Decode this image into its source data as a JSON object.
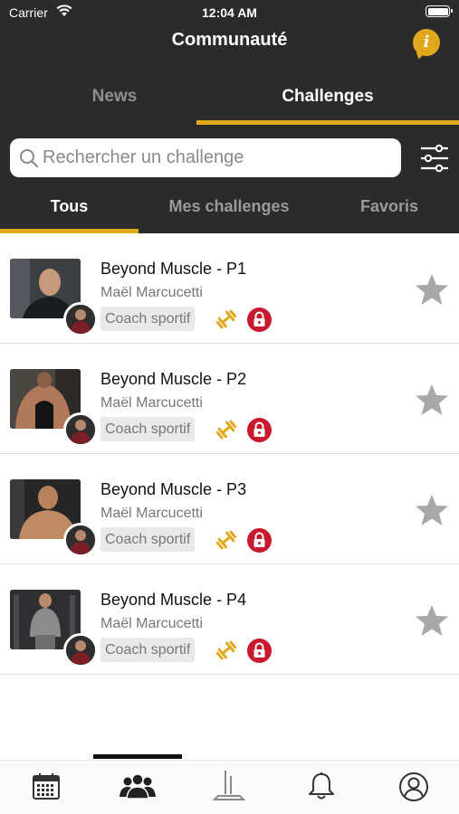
{
  "status_bar": {
    "carrier": "Carrier",
    "time": "12:04 AM"
  },
  "header": {
    "title": "Communauté",
    "info_icon": "i"
  },
  "top_tabs": [
    {
      "label": "News",
      "active": false
    },
    {
      "label": "Challenges",
      "active": true
    }
  ],
  "search": {
    "placeholder": "Rechercher un challenge",
    "value": ""
  },
  "sub_tabs": [
    {
      "label": "Tous",
      "active": true
    },
    {
      "label": "Mes challenges",
      "active": false
    },
    {
      "label": "Favoris",
      "active": false
    }
  ],
  "challenges": [
    {
      "title": "Beyond Muscle - P1",
      "author": "Maël Marcucetti",
      "badge": "Coach sportif",
      "locked": true,
      "favorite": false
    },
    {
      "title": "Beyond Muscle - P2",
      "author": "Maël Marcucetti",
      "badge": "Coach sportif",
      "locked": true,
      "favorite": false
    },
    {
      "title": "Beyond Muscle - P3",
      "author": "Maël Marcucetti",
      "badge": "Coach sportif",
      "locked": true,
      "favorite": false
    },
    {
      "title": "Beyond Muscle - P4",
      "author": "Maël Marcucetti",
      "badge": "Coach sportif",
      "locked": true,
      "favorite": false
    }
  ],
  "tab_bar": [
    {
      "icon": "calendar-icon",
      "active": false
    },
    {
      "icon": "community-icon",
      "active": true
    },
    {
      "icon": "stats-icon",
      "active": false
    },
    {
      "icon": "bell-icon",
      "active": false
    },
    {
      "icon": "profile-icon",
      "active": false
    }
  ],
  "colors": {
    "header_bg": "#2b2b2b",
    "accent": "#e0a81c",
    "lock": "#c8192e",
    "star": "#a8a8a8"
  }
}
